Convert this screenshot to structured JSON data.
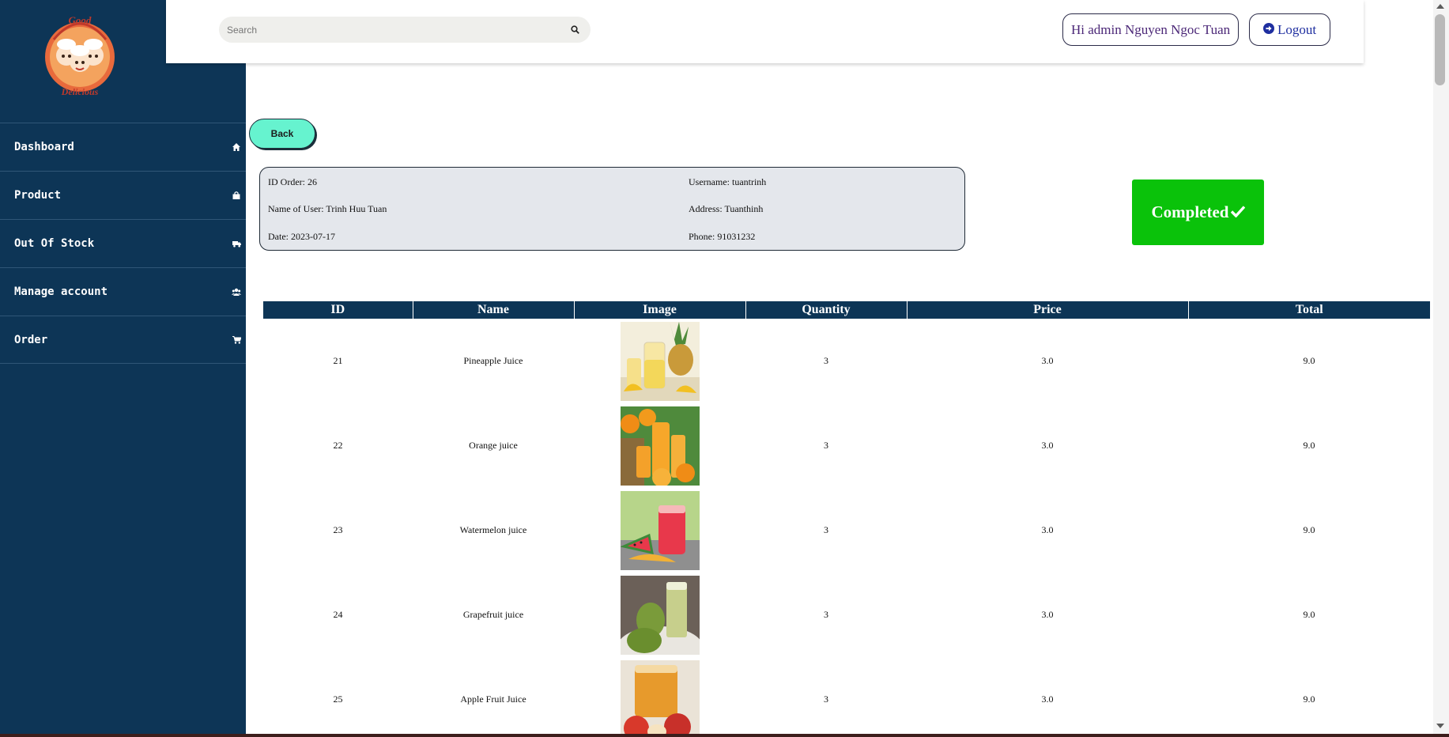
{
  "brand": {
    "logo_text_top": "Good",
    "logo_text_bottom": "Delicious"
  },
  "sidebar": {
    "items": [
      {
        "label": "Dashboard",
        "icon": "home-icon"
      },
      {
        "label": "Product",
        "icon": "bag-icon"
      },
      {
        "label": "Out Of Stock",
        "icon": "truck-icon"
      },
      {
        "label": "Manage account",
        "icon": "users-icon"
      },
      {
        "label": "Order",
        "icon": "cart-icon"
      }
    ]
  },
  "header": {
    "search_placeholder": "Search",
    "greeting": "Hi admin Nguyen Ngoc Tuan",
    "logout_label": "Logout"
  },
  "back_label": "Back",
  "order": {
    "id": "ID Order: 26",
    "name_of_user": "Name of User: Trinh Huu Tuan",
    "date": "Date: 2023-07-17",
    "username": "Username: tuantrinh",
    "address": "Address: Tuanthinh",
    "phone": "Phone: 91031232",
    "status": "Completed"
  },
  "table": {
    "columns": [
      "ID",
      "Name",
      "Image",
      "Quantity",
      "Price",
      "Total"
    ],
    "rows": [
      {
        "id": "21",
        "name": "Pineapple Juice",
        "image": "pineapple-juice-image",
        "quantity": "3",
        "price": "3.0",
        "total": "9.0"
      },
      {
        "id": "22",
        "name": "Orange juice",
        "image": "orange-juice-image",
        "quantity": "3",
        "price": "3.0",
        "total": "9.0"
      },
      {
        "id": "23",
        "name": "Watermelon juice",
        "image": "watermelon-juice-image",
        "quantity": "3",
        "price": "3.0",
        "total": "9.0"
      },
      {
        "id": "24",
        "name": "Grapefruit juice",
        "image": "grapefruit-juice-image",
        "quantity": "3",
        "price": "3.0",
        "total": "9.0"
      },
      {
        "id": "25",
        "name": "Apple Fruit Juice",
        "image": "apple-juice-image",
        "quantity": "3",
        "price": "3.0",
        "total": "9.0"
      }
    ]
  },
  "colors": {
    "sidebar": "#0d3556",
    "back_button": "#66f3cf",
    "status_completed": "#0ac20a",
    "greeting_text": "#4b2777",
    "logout_text": "#1f2fa0"
  }
}
